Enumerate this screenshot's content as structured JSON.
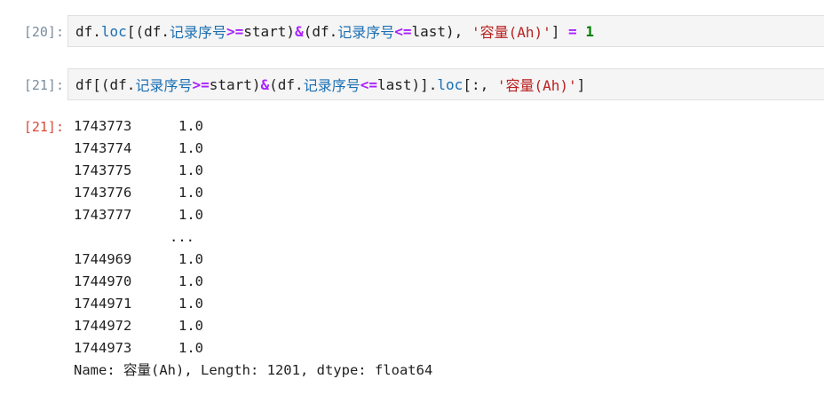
{
  "cells": [
    {
      "prompt": "[20]:",
      "tokens": [
        {
          "t": "df.",
          "c": "plain"
        },
        {
          "t": "loc",
          "c": "fn"
        },
        {
          "t": "[(df.",
          "c": "plain"
        },
        {
          "t": "记录序号",
          "c": "fn"
        },
        {
          "t": ">=",
          "c": "op"
        },
        {
          "t": "start)",
          "c": "plain"
        },
        {
          "t": "&",
          "c": "op"
        },
        {
          "t": "(df.",
          "c": "plain"
        },
        {
          "t": "记录序号",
          "c": "fn"
        },
        {
          "t": "<=",
          "c": "op"
        },
        {
          "t": "last), ",
          "c": "plain"
        },
        {
          "t": "'容量(Ah)'",
          "c": "str"
        },
        {
          "t": "] ",
          "c": "plain"
        },
        {
          "t": "=",
          "c": "op"
        },
        {
          "t": " ",
          "c": "plain"
        },
        {
          "t": "1",
          "c": "num"
        }
      ]
    },
    {
      "prompt": "[21]:",
      "tokens": [
        {
          "t": "df[(df.",
          "c": "plain"
        },
        {
          "t": "记录序号",
          "c": "fn"
        },
        {
          "t": ">=",
          "c": "op"
        },
        {
          "t": "start)",
          "c": "plain"
        },
        {
          "t": "&",
          "c": "op"
        },
        {
          "t": "(df.",
          "c": "plain"
        },
        {
          "t": "记录序号",
          "c": "fn"
        },
        {
          "t": "<=",
          "c": "op"
        },
        {
          "t": "last)].",
          "c": "plain"
        },
        {
          "t": "loc",
          "c": "fn"
        },
        {
          "t": "[:, ",
          "c": "plain"
        },
        {
          "t": "'容量(Ah)'",
          "c": "str"
        },
        {
          "t": "]",
          "c": "plain"
        }
      ]
    }
  ],
  "output": {
    "prompt": "[21]:",
    "rows_head": [
      {
        "index": "1743773",
        "value": "1.0"
      },
      {
        "index": "1743774",
        "value": "1.0"
      },
      {
        "index": "1743775",
        "value": "1.0"
      },
      {
        "index": "1743776",
        "value": "1.0"
      },
      {
        "index": "1743777",
        "value": "1.0"
      }
    ],
    "ellipsis": "...",
    "rows_tail": [
      {
        "index": "1744969",
        "value": "1.0"
      },
      {
        "index": "1744970",
        "value": "1.0"
      },
      {
        "index": "1744971",
        "value": "1.0"
      },
      {
        "index": "1744972",
        "value": "1.0"
      },
      {
        "index": "1744973",
        "value": "1.0"
      }
    ],
    "footer": "Name: 容量(Ah), Length: 1201, dtype: float64"
  }
}
